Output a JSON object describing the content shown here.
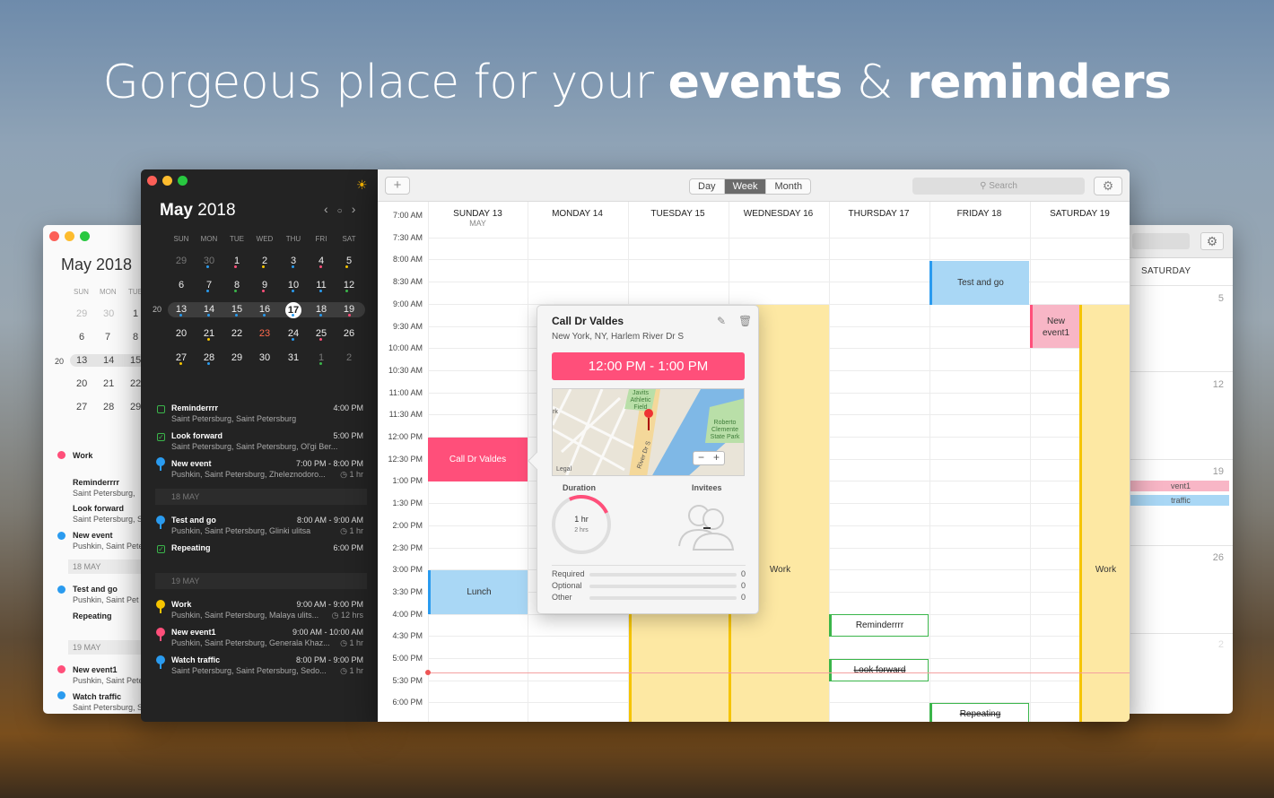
{
  "headline": {
    "pre": "Gorgeous place for your ",
    "b1": "events",
    "mid": " & ",
    "b2": "reminders"
  },
  "left_window": {
    "title": "May 2018",
    "headers": [
      "SUN",
      "MON",
      "TUE"
    ],
    "weeks": [
      [
        "29",
        "30",
        "1"
      ],
      [
        "6",
        "7",
        "8"
      ],
      [
        "13",
        "14",
        "15"
      ],
      [
        "20",
        "21",
        "22"
      ],
      [
        "27",
        "28",
        "29"
      ]
    ],
    "week_number": "20",
    "items": [
      {
        "title": "Work",
        "sub": ""
      },
      {
        "title": "Reminderrrr",
        "sub": "Saint Petersburg,"
      },
      {
        "title": "Look forward",
        "sub": "Saint Petersburg, S"
      },
      {
        "title": "New event",
        "sub": "Pushkin, Saint Pete"
      },
      {
        "title": "Test and go",
        "sub": "Pushkin, Saint Pet"
      },
      {
        "title": "Repeating",
        "sub": ""
      },
      {
        "title": "New event1",
        "sub": "Pushkin, Saint Pete"
      },
      {
        "title": "Watch traffic",
        "sub": "Saint Petersburg, S"
      }
    ],
    "sections": [
      "18 MAY",
      "19 MAY"
    ]
  },
  "right_window": {
    "header": "SATURDAY",
    "days": [
      "5",
      "12",
      "19",
      "26",
      "2"
    ],
    "events": [
      {
        "label": "vent1",
        "color": "#f8b6c6"
      },
      {
        "label": "traffic",
        "color": "#a9d7f5"
      }
    ]
  },
  "sidebar": {
    "month": "May",
    "year": "2018",
    "weekdays": [
      "SUN",
      "MON",
      "TUE",
      "WED",
      "THU",
      "FRI",
      "SAT"
    ],
    "week_number": "20",
    "weeks": [
      [
        "29",
        "30",
        "1",
        "2",
        "3",
        "4",
        "5"
      ],
      [
        "6",
        "7",
        "8",
        "9",
        "10",
        "11",
        "12"
      ],
      [
        "13",
        "14",
        "15",
        "16",
        "17",
        "18",
        "19"
      ],
      [
        "20",
        "21",
        "22",
        "23",
        "24",
        "25",
        "26"
      ],
      [
        "27",
        "28",
        "29",
        "30",
        "31",
        "1",
        "2"
      ]
    ],
    "today": "17",
    "agenda": [
      {
        "title": "Reminderrrr",
        "time": "4:00 PM",
        "sub": "Saint Petersburg, Saint Petersburg",
        "dur": ""
      },
      {
        "title": "Look forward",
        "time": "5:00 PM",
        "sub": "Saint Petersburg, Saint Petersburg, Ol'gi Ber...",
        "dur": ""
      },
      {
        "title": "New event",
        "time": "7:00 PM - 8:00 PM",
        "sub": "Pushkin, Saint Petersburg, Zheleznodoro...",
        "dur": "1 hr"
      },
      {
        "title": "Test and go",
        "time": "8:00 AM - 9:00 AM",
        "sub": "Pushkin, Saint Petersburg, Glinki ulitsa",
        "dur": "1 hr"
      },
      {
        "title": "Repeating",
        "time": "6:00 PM",
        "sub": "",
        "dur": ""
      },
      {
        "title": "Work",
        "time": "9:00 AM - 9:00 PM",
        "sub": "Pushkin, Saint Petersburg, Malaya ulits...",
        "dur": "12 hrs"
      },
      {
        "title": "New event1",
        "time": "9:00 AM - 10:00 AM",
        "sub": "Pushkin, Saint Petersburg, Generala Khaz...",
        "dur": "1 hr"
      },
      {
        "title": "Watch traffic",
        "time": "8:00 PM - 9:00 PM",
        "sub": "Saint Petersburg, Saint Petersburg, Sedo...",
        "dur": "1 hr"
      }
    ],
    "sections": [
      "18 MAY",
      "19 MAY"
    ]
  },
  "toolbar": {
    "views": [
      "Day",
      "Week",
      "Month"
    ],
    "active": "Week",
    "search_placeholder": "Search"
  },
  "week": {
    "days": [
      {
        "label": "SUNDAY 13",
        "sub": "MAY"
      },
      {
        "label": "MONDAY 14",
        "sub": ""
      },
      {
        "label": "TUESDAY 15",
        "sub": ""
      },
      {
        "label": "WEDNESDAY 16",
        "sub": ""
      },
      {
        "label": "THURSDAY 17",
        "sub": ""
      },
      {
        "label": "FRIDAY 18",
        "sub": ""
      },
      {
        "label": "SATURDAY 19",
        "sub": ""
      }
    ],
    "times": [
      "7:00 AM",
      "7:30 AM",
      "8:00 AM",
      "8:30 AM",
      "9:00 AM",
      "9:30 AM",
      "10:00 AM",
      "10:30 AM",
      "11:00 AM",
      "11:30 AM",
      "12:00 PM",
      "12:30 PM",
      "1:00 PM",
      "1:30 PM",
      "2:00 PM",
      "2:30 PM",
      "3:00 PM",
      "3:30 PM",
      "4:00 PM",
      "4:30 PM",
      "5:00 PM",
      "5:30 PM",
      "6:00 PM"
    ],
    "events": {
      "call": "Call Dr Valdes",
      "lunch": "Lunch",
      "test": "Test and go",
      "new1": "New event1",
      "work_wed": "Work",
      "work_sat": "Work",
      "reminder": "Reminderrrr",
      "look": "Look forward",
      "repeat": "Repeating"
    }
  },
  "popup": {
    "title": "Call Dr Valdes",
    "location": "New York, NY, Harlem River Dr S",
    "time_range": "12:00 PM - 1:00 PM",
    "map_labels": {
      "field": "Javits Athletic Field",
      "park": "Roberto Clemente State Park",
      "road": "River Dr S",
      "legal": "Legal",
      "rk": "rk"
    },
    "duration_label": "Duration",
    "duration_value": "1 hr",
    "duration_max": "2 hrs",
    "invitees_label": "Invitees",
    "rows": [
      {
        "label": "Required",
        "count": "0"
      },
      {
        "label": "Optional",
        "count": "0"
      },
      {
        "label": "Other",
        "count": "0"
      }
    ]
  },
  "colors": {
    "pink": "#ff4f7a",
    "blue": "#a9d7f5",
    "yellow": "#fde8a3",
    "green": "#3ab54a",
    "accent_yellow": "#f5c400"
  }
}
